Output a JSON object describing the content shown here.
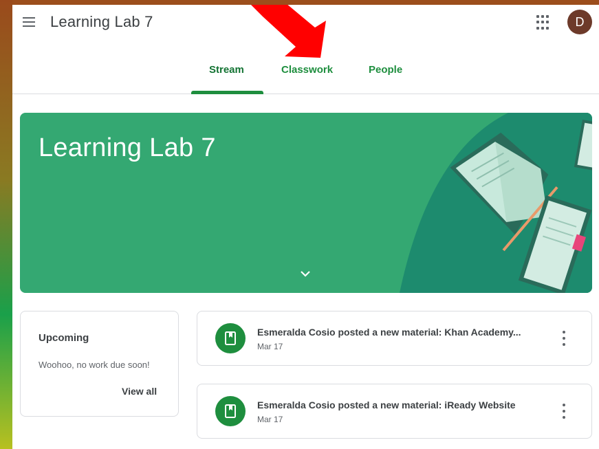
{
  "header": {
    "title": "Learning Lab 7",
    "avatar_initial": "D",
    "menu_icon": "hamburger-menu-icon",
    "apps_icon": "apps-grid-icon"
  },
  "tabs": [
    {
      "label": "Stream",
      "active": true
    },
    {
      "label": "Classwork",
      "active": false
    },
    {
      "label": "People",
      "active": false
    }
  ],
  "banner": {
    "title": "Learning Lab 7",
    "color": "#34a872",
    "expand_icon": "chevron-down-icon"
  },
  "upcoming": {
    "title": "Upcoming",
    "message": "Woohoo, no work due soon!",
    "view_all": "View all"
  },
  "posts": [
    {
      "title": "Esmeralda Cosio posted a new material: Khan Academy...",
      "date": "Mar 17",
      "icon": "material-book-icon"
    },
    {
      "title": "Esmeralda Cosio posted a new material: iReady Website",
      "date": "Mar 17",
      "icon": "material-book-icon"
    }
  ],
  "colors": {
    "accent": "#1e8e3e",
    "annotation_arrow": "#ff0000"
  }
}
